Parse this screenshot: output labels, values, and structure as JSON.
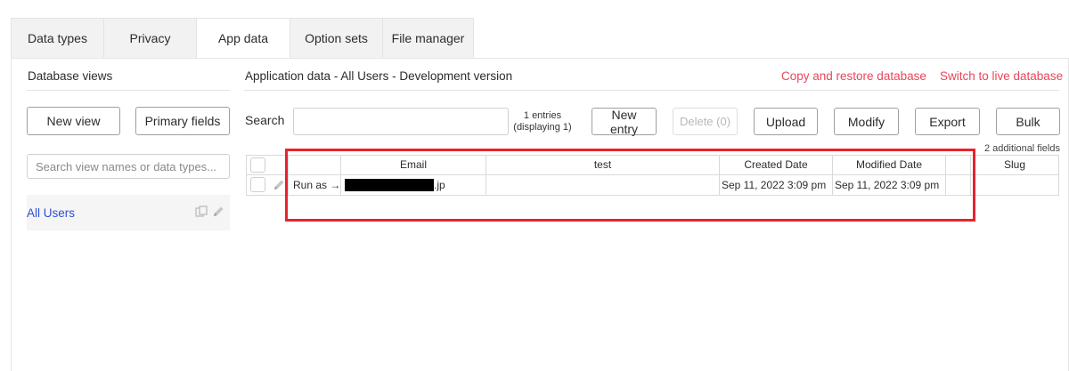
{
  "tabs": [
    {
      "label": "Data types"
    },
    {
      "label": "Privacy"
    },
    {
      "label": "App data"
    },
    {
      "label": "Option sets"
    },
    {
      "label": "File manager"
    }
  ],
  "left": {
    "title": "Database views",
    "new_view": "New view",
    "primary_fields": "Primary fields",
    "search_placeholder": "Search view names or data types...",
    "selected_view": "All Users"
  },
  "main": {
    "title": "Application data - All Users - Development version",
    "copy_restore": "Copy and restore database",
    "switch_live": "Switch to live database",
    "search_label": "Search",
    "entries_line1": "1 entries",
    "entries_line2": "(displaying 1)",
    "buttons": {
      "new_entry": "New entry",
      "delete": "Delete (0)",
      "upload": "Upload",
      "modify": "Modify",
      "export": "Export",
      "bulk": "Bulk"
    },
    "additional_fields": "2 additional fields"
  },
  "table": {
    "headers": {
      "email": "Email",
      "test": "test",
      "created": "Created Date",
      "modified": "Modified Date",
      "extra": "",
      "slug": "Slug"
    },
    "rows": [
      {
        "run_as": "Run as →",
        "email_suffix": ".jp",
        "test": "",
        "created": "Sep 11, 2022 3:09 pm",
        "modified": "Sep 11, 2022 3:09 pm",
        "extra": "",
        "slug": ""
      }
    ]
  },
  "colors": {
    "accent_link": "#e8455a",
    "selected_link": "#2f4fd1",
    "highlight_box": "#e8232e"
  }
}
